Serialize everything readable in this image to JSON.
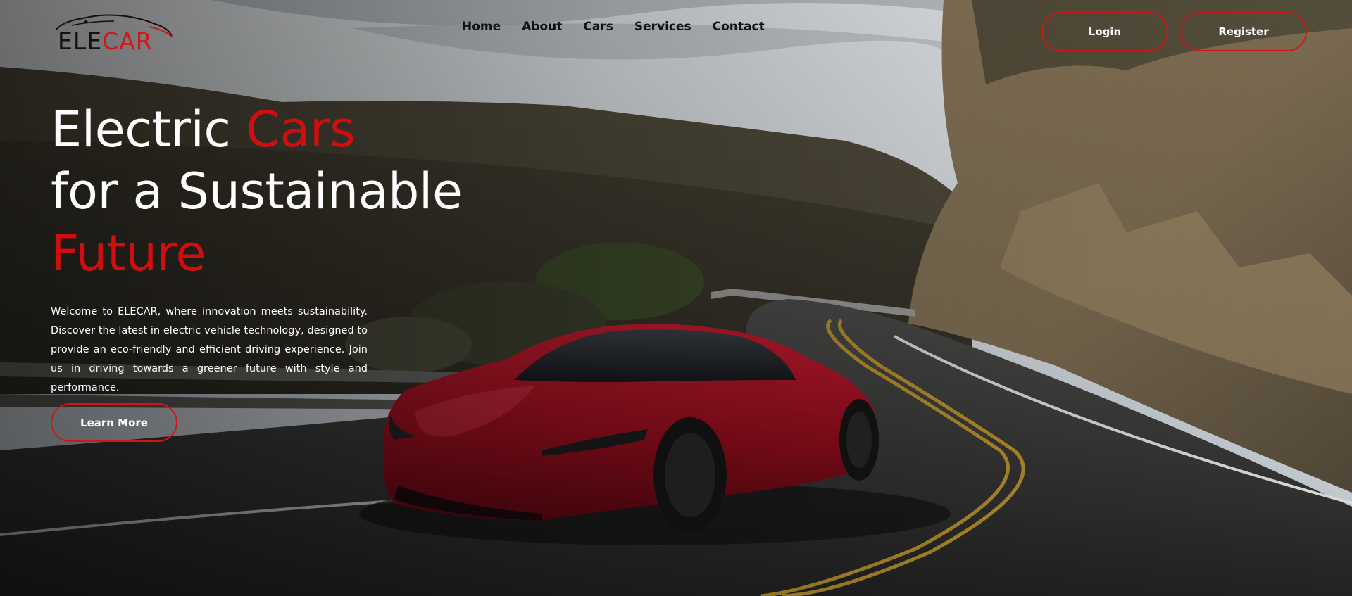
{
  "brand": {
    "name_part1": "ELE",
    "name_part2": "CAR",
    "accent_color": "#d11519"
  },
  "nav": {
    "items": [
      {
        "label": "Home"
      },
      {
        "label": "About"
      },
      {
        "label": "Cars"
      },
      {
        "label": "Services"
      },
      {
        "label": "Contact"
      }
    ]
  },
  "auth": {
    "login_label": "Login",
    "register_label": "Register"
  },
  "hero": {
    "headline_line1_white": "Electric ",
    "headline_line1_red": "Cars",
    "headline_line2": "for a Sustainable",
    "headline_line3_red": "Future",
    "intro": "Welcome to ELECAR, where innovation meets sustainability. Discover the latest in electric vehicle technology, designed to provide an eco-friendly and efficient driving experience. Join us in driving towards a greener future with style and performance.",
    "cta_label": "Learn More",
    "background_image": "red-electric-sports-car-on-mountain-road"
  }
}
